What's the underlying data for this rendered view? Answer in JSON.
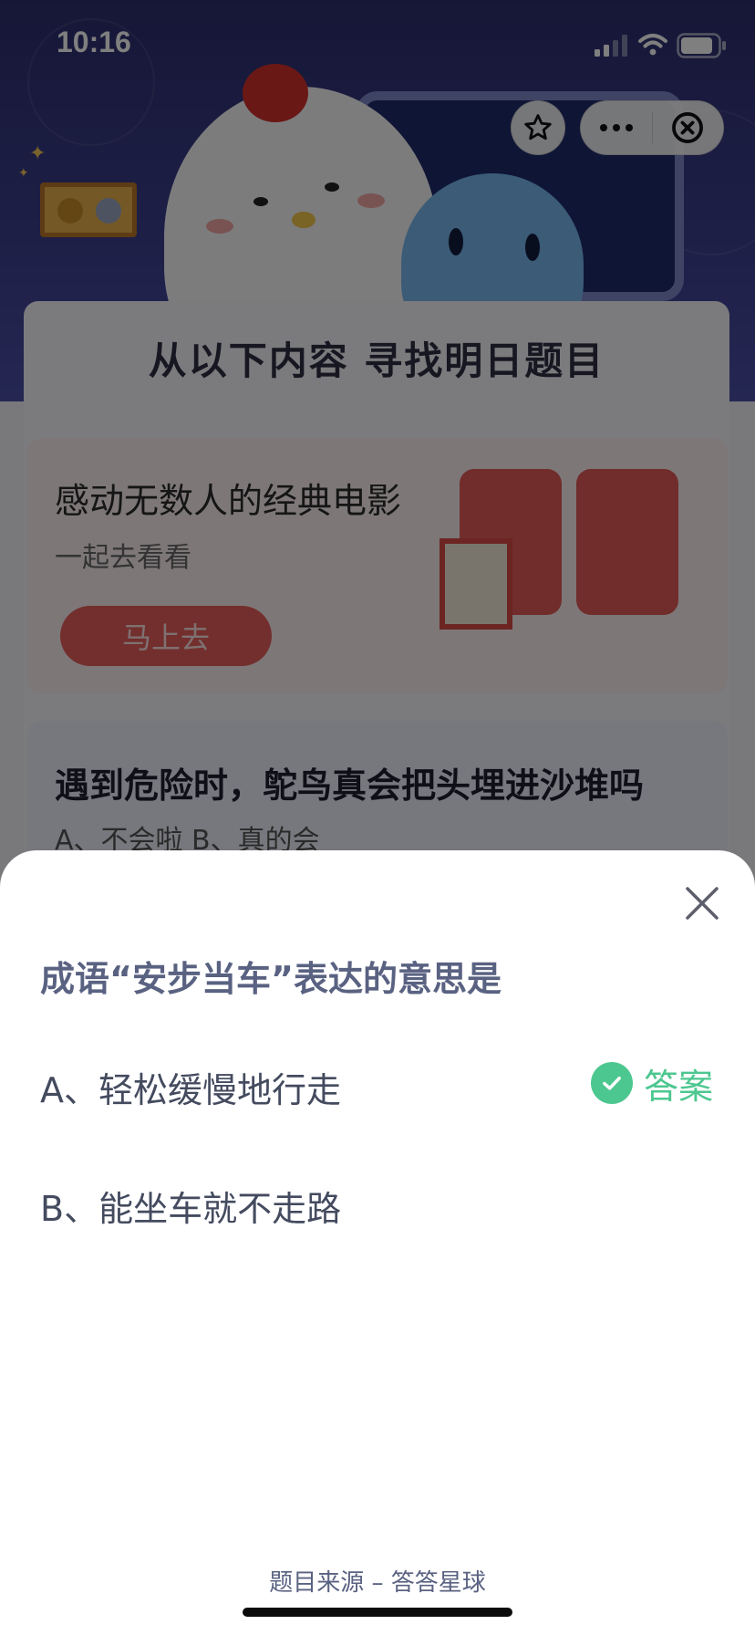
{
  "status_bar": {
    "time": "10:16"
  },
  "background": {
    "panel_title": "从以下内容  寻找明日题目",
    "movie_card": {
      "title": "感动无数人的经典电影",
      "subtitle": "一起去看看",
      "button": "马上去"
    },
    "quiz_card": {
      "question": "遇到危险时，鸵鸟真会把头埋进沙堆吗",
      "options": "A、不会啦    B、真的会"
    }
  },
  "sheet": {
    "question": "成语“安步当车”表达的意思是",
    "options": [
      {
        "label": "A、轻松缓慢地行走"
      },
      {
        "label": "B、能坐车就不走路"
      }
    ],
    "answer_label": "答案",
    "source": "题目来源 – 答答星球"
  },
  "colors": {
    "accent_green": "#4cc78f",
    "title_blue_gray": "#5a6282",
    "button_red": "#e65e5a"
  }
}
